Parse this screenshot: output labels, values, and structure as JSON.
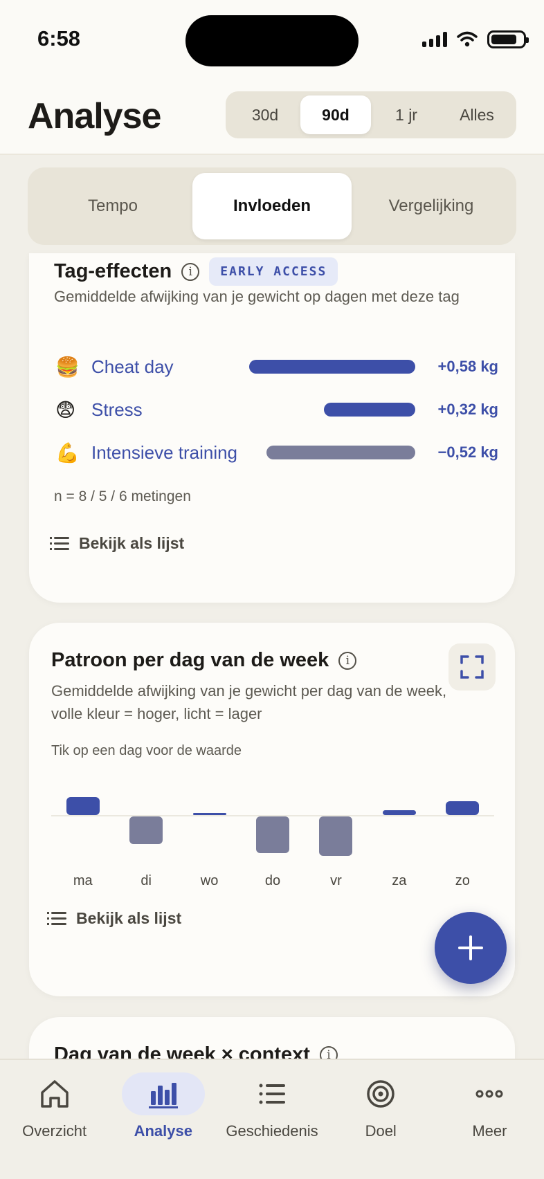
{
  "status": {
    "time": "6:58"
  },
  "header": {
    "title": "Analyse",
    "ranges": [
      "30d",
      "90d",
      "1 jr",
      "Alles"
    ],
    "active_range": "90d"
  },
  "tabs": [
    "Tempo",
    "Invloeden",
    "Vergelijking"
  ],
  "active_tab": "Invloeden",
  "tag_effects": {
    "title": "Tag-effecten",
    "badge": "EARLY ACCESS",
    "description": "Gemiddelde afwijking van je gewicht op dagen met deze tag",
    "items": [
      {
        "emoji": "🍔",
        "label": "Cheat day",
        "value": "+0,58 kg",
        "amount": 0.58,
        "color": "#3d4fa8"
      },
      {
        "emoji": "😨",
        "label": "Stress",
        "value": "+0,32 kg",
        "amount": 0.32,
        "color": "#3d4fa8"
      },
      {
        "emoji": "💪",
        "label": "Intensieve training",
        "value": "−0,52 kg",
        "amount": -0.52,
        "color": "#7a7d9a"
      }
    ],
    "n_text": "n = 8 / 5 / 6 metingen",
    "list_link": "Bekijk als lijst"
  },
  "weekday_pattern": {
    "title": "Patroon per dag van de week",
    "description": "Gemiddelde afwijking van je gewicht per dag van de week, volle kleur = hoger, licht = lager",
    "hint": "Tik op een dag voor de waarde",
    "list_link": "Bekijk als lijst",
    "chart_data": {
      "type": "bar",
      "categories": [
        "ma",
        "di",
        "wo",
        "do",
        "vr",
        "za",
        "zo"
      ],
      "values": [
        0.24,
        -0.36,
        0.02,
        -0.48,
        -0.52,
        0.06,
        0.18
      ],
      "positive_color": "#3d4fa8",
      "negative_color": "#7a7d9a"
    }
  },
  "next_card": {
    "title": "Dag van de week × context"
  },
  "bottom_nav": [
    {
      "label": "Overzicht",
      "icon": "home-icon"
    },
    {
      "label": "Analyse",
      "icon": "bar-chart-icon"
    },
    {
      "label": "Geschiedenis",
      "icon": "list-icon"
    },
    {
      "label": "Doel",
      "icon": "target-icon"
    },
    {
      "label": "Meer",
      "icon": "more-dots-icon"
    }
  ],
  "active_nav": "Analyse"
}
